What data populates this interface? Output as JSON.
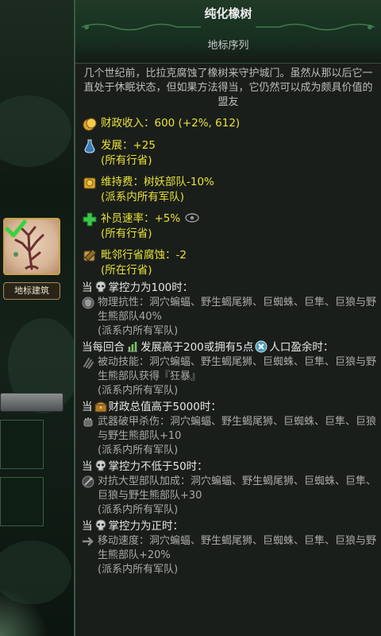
{
  "left_panel": {
    "card_label": "地标建筑"
  },
  "panel": {
    "title": "纯化橡树",
    "subtitle": "地标序列",
    "description": "几个世纪前，比拉克腐蚀了橡树来守护城门。虽然从那以后它一直处于休眠状态，但如果方法得当，它仍然可以成为颇具价值的盟友"
  },
  "stats": [
    {
      "icon": "gold-coins-icon",
      "text": "财政收入：600 (+2%, 612)"
    },
    {
      "icon": "development-potion-icon",
      "text": "发展：+25",
      "sub": "(所有行省)"
    },
    {
      "icon": "upkeep-coins-icon",
      "text": "维持费：树妖部队-10%",
      "sub": "(派系内所有军队)"
    },
    {
      "icon": "green-plus-icon",
      "text": "补员速率：+5%",
      "sub": "(所有行省)"
    },
    {
      "icon": "corruption-scroll-icon",
      "text": "毗邻行省腐蚀：-2",
      "sub": "(所在行省)"
    }
  ],
  "conditions": [
    {
      "prefix": "当",
      "icon": "skull-icon",
      "text": "掌控力为100时：",
      "effect_icon": "shield-effect-icon",
      "effect": "物理抗性：洞穴蝙蝠、野生蝎尾狮、巨蜘蛛、巨隼、巨狼与野生熊部队40%",
      "sub": "(派系内所有军队)"
    },
    {
      "prefix": "当每回合",
      "icon": "growth-icon",
      "text": "发展高于200或拥有5点",
      "icon2": "x-badge-icon",
      "text2": "人口盈余时：",
      "effect_icon": "claw-effect-icon",
      "effect": "被动技能：洞穴蝙蝠、野生蝎尾狮、巨蜘蛛、巨隼、巨狼与野生熊部队获得『狂暴』",
      "sub": "(派系内所有军队)"
    },
    {
      "prefix": "当",
      "icon": "treasure-chest-icon",
      "text": "财政总值高于5000时：",
      "effect_icon": "fist-effect-icon",
      "effect": "武器破甲杀伤：洞穴蝙蝠、野生蝎尾狮、巨蜘蛛、巨隼、巨狼与野生熊部队+10",
      "sub": "(派系内所有军队)"
    },
    {
      "prefix": "当",
      "icon": "skull-icon",
      "text": "掌控力不低于50时：",
      "effect_icon": "sword-effect-icon",
      "effect": "对抗大型部队加成：洞穴蝙蝠、野生蝎尾狮、巨蜘蛛、巨隼、巨狼与野生熊部队+30",
      "sub": "(派系内所有军队)"
    },
    {
      "prefix": "当",
      "icon": "skull-icon",
      "text": "掌控力为正时：",
      "effect_icon": "arrow-effect-icon",
      "effect": "移动速度：洞穴蝙蝠、野生蝎尾狮、巨蜘蛛、巨隼、巨狼与野生熊部队+20%",
      "sub": "(派系内所有军队)"
    }
  ],
  "colors": {
    "accent_yellow": "#e8e23a",
    "panel_bg": "#1a1e1a",
    "header_green": "#1f3a26"
  }
}
